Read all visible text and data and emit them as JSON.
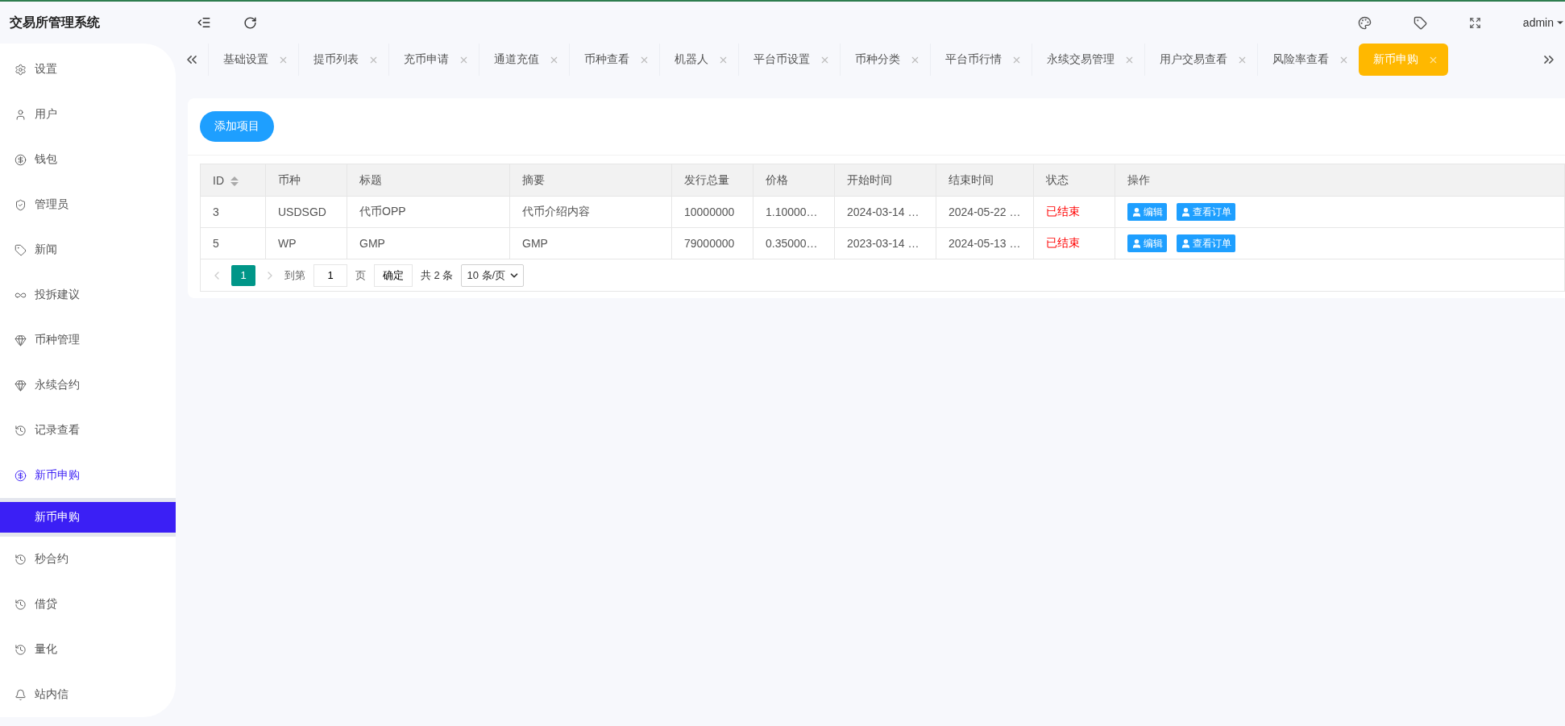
{
  "app_title": "交易所管理系统",
  "header": {
    "user": "admin"
  },
  "sidebar": {
    "items": [
      {
        "label": "设置",
        "selected": false
      },
      {
        "label": "用户",
        "selected": false
      },
      {
        "label": "钱包",
        "selected": false
      },
      {
        "label": "管理员",
        "selected": false
      },
      {
        "label": "新闻",
        "selected": false
      },
      {
        "label": "投拆建议",
        "selected": false
      },
      {
        "label": "币种管理",
        "selected": false
      },
      {
        "label": "永续合约",
        "selected": false
      },
      {
        "label": "记录查看",
        "selected": false
      },
      {
        "label": "新币申购",
        "selected": false,
        "expanded": true,
        "children": [
          {
            "label": "新币申购",
            "selected": true
          }
        ]
      },
      {
        "label": "秒合约",
        "selected": false
      },
      {
        "label": "借贷",
        "selected": false
      },
      {
        "label": "量化",
        "selected": false
      },
      {
        "label": "站内信",
        "selected": false
      }
    ]
  },
  "tabs": [
    {
      "label": "基础设置",
      "selected": false
    },
    {
      "label": "提币列表",
      "selected": false
    },
    {
      "label": "充币申请",
      "selected": false
    },
    {
      "label": "通道充值",
      "selected": false
    },
    {
      "label": "币种查看",
      "selected": false
    },
    {
      "label": "机器人",
      "selected": false
    },
    {
      "label": "平台币设置",
      "selected": false
    },
    {
      "label": "币种分类",
      "selected": false
    },
    {
      "label": "平台币行情",
      "selected": false
    },
    {
      "label": "永续交易管理",
      "selected": false
    },
    {
      "label": "用户交易查看",
      "selected": false
    },
    {
      "label": "风险率查看",
      "selected": false
    },
    {
      "label": "新币申购",
      "selected": true
    }
  ],
  "add_button": "添加项目",
  "table": {
    "columns": [
      "ID",
      "币种",
      "标题",
      "摘要",
      "发行总量",
      "价格",
      "开始时间",
      "结束时间",
      "状态",
      "操作"
    ],
    "rows": [
      {
        "cells": [
          "3",
          "USDSGD",
          "代币OPP",
          "代币介绍内容",
          "10000000",
          "1.10000…",
          "2024-03-14 …",
          "2024-05-22 …",
          "已结束"
        ],
        "actions": [
          "编辑",
          "查看订单"
        ]
      },
      {
        "cells": [
          "5",
          "WP",
          "GMP",
          "GMP",
          "79000000",
          "0.35000…",
          "2023-03-14 …",
          "2024-05-13 …",
          "已结束"
        ],
        "actions": [
          "编辑",
          "查看订单"
        ]
      }
    ]
  },
  "pagination": {
    "pages": [
      {
        "label": "1",
        "selected": true
      }
    ],
    "goto_label": "到第",
    "page_input": "1",
    "page_unit": "页",
    "confirm": "确定",
    "total": "共 2 条",
    "page_size": "10 条/页"
  }
}
